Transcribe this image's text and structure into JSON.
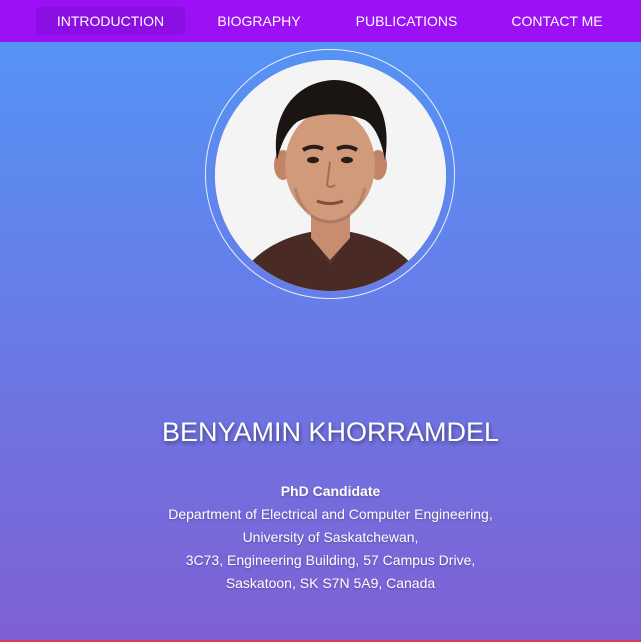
{
  "nav": {
    "items": [
      {
        "label": "INTRODUCTION"
      },
      {
        "label": "BIOGRAPHY"
      },
      {
        "label": "PUBLICATIONS"
      },
      {
        "label": "CONTACT ME"
      }
    ]
  },
  "profile": {
    "name": "BENYAMIN KHORRAMDEL",
    "role": "PhD Candidate",
    "address_lines": [
      "Department of Electrical and Computer Engineering,",
      "University of Saskatchewan,",
      "3C73, Engineering Building, 57 Campus Drive,",
      "Saskatoon, SK S7N 5A9, Canada"
    ]
  },
  "colors": {
    "nav_bg": "#9b10f5",
    "nav_active_bg": "#8b0ee2",
    "gradient_top": "#5197f6",
    "gradient_bottom": "#7f60d4",
    "text": "#ffffff"
  }
}
